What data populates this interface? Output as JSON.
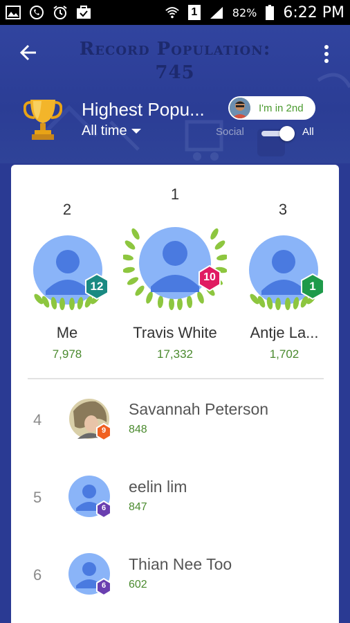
{
  "status_bar": {
    "battery": "82%",
    "time": "6:22 PM",
    "sim": "1"
  },
  "header": {
    "record_title_line1": "Record Population:",
    "record_title_line2": "745",
    "leaderboard_title": "Highest Popu...",
    "period": "All time",
    "rank_chip": "I'm in 2nd",
    "social_label": "Social",
    "all_label": "All",
    "toggle_state": "All"
  },
  "podium": [
    {
      "position": "2",
      "name": "Me",
      "score": "7,978",
      "level": "12",
      "badge_color": "#1a8a82"
    },
    {
      "position": "1",
      "name": "Travis White",
      "score": "17,332",
      "level": "10",
      "badge_color": "#e01b62"
    },
    {
      "position": "3",
      "name": "Antje La...",
      "score": "1,702",
      "level": "1",
      "badge_color": "#1e9a4a"
    }
  ],
  "list": [
    {
      "rank": "4",
      "name": "Savannah Peterson",
      "score": "848",
      "level": "9",
      "badge_color": "#f06020",
      "photo": true
    },
    {
      "rank": "5",
      "name": "eelin lim",
      "score": "847",
      "level": "6",
      "badge_color": "#6a3fb0",
      "photo": false
    },
    {
      "rank": "6",
      "name": "Thian Nee Too",
      "score": "602",
      "level": "6",
      "badge_color": "#6a3fb0",
      "photo": false
    }
  ],
  "colors": {
    "header_bg": "#2f4398",
    "score_green": "#4a8a2e",
    "avatar_blue": "#8ab4f8",
    "avatar_dark": "#4a7ae0"
  }
}
